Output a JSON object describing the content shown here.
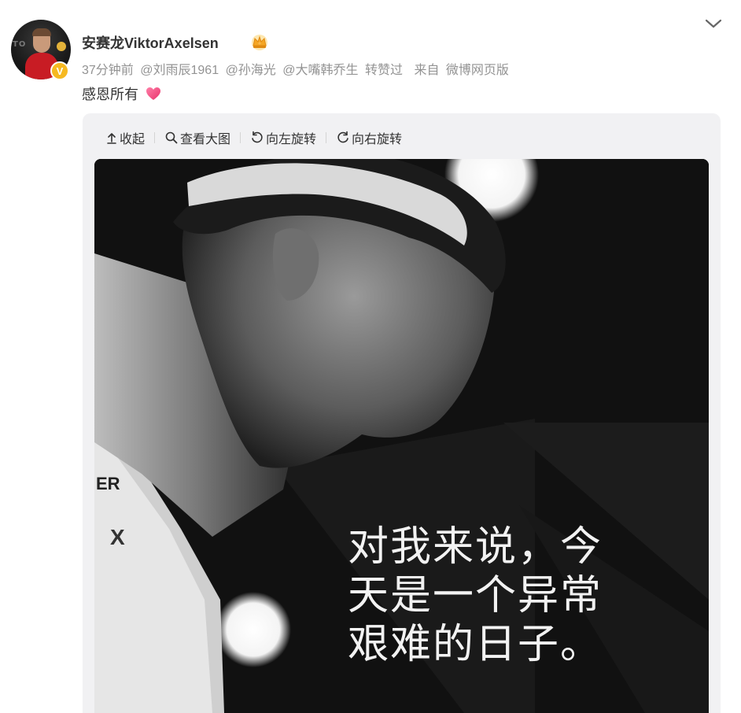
{
  "post": {
    "author": {
      "name": "安赛龙ViktorAxelsen",
      "verified_badge": "V",
      "avatar_icon": "athlete-avatar",
      "crown_icon": "crown-icon"
    },
    "meta": {
      "time": "37分钟前",
      "mentions": [
        "@刘雨辰1961",
        "@孙海光",
        "@大嘴韩乔生"
      ],
      "reposted_label": "转赞过",
      "source_prefix": "来自",
      "source": "微博网页版"
    },
    "text": "感恩所有",
    "emoji": "heart-icon"
  },
  "toolbar": {
    "collapse": "收起",
    "view_large": "查看大图",
    "rotate_left": "向左旋转",
    "rotate_right": "向右旋转"
  },
  "image": {
    "caption_lines": [
      "对我来说，今",
      "天是一个异常",
      "艰难的日子。"
    ],
    "description_icon": "badminton-player-photo"
  },
  "colors": {
    "accent_badge": "#f6b921",
    "meta_gray": "#939393",
    "card_bg": "#f1f1f3",
    "heart": "#f04b7a"
  }
}
